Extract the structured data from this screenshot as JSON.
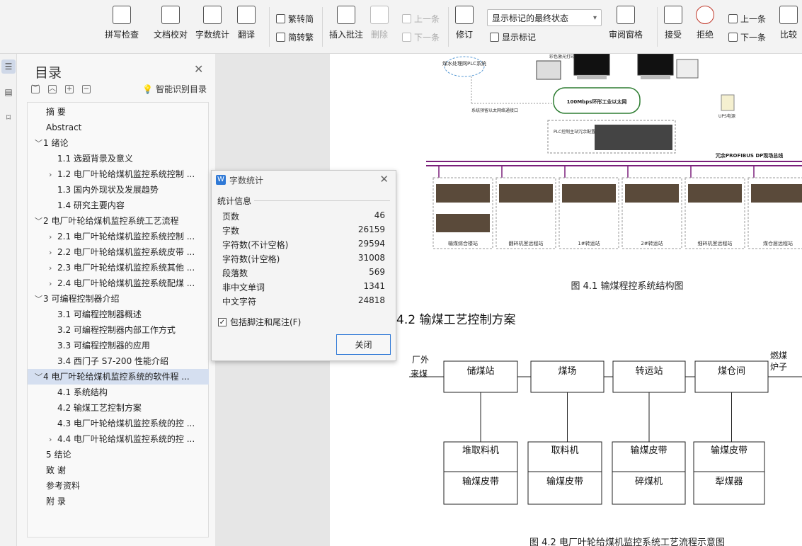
{
  "ribbon": {
    "spell_check": "拼写检查",
    "doc_proof": "文档校对",
    "word_count": "字数统计",
    "translate": "翻译",
    "to_traditional": "繁转简",
    "to_simplified": "简转繁",
    "insert_comment": "插入批注",
    "delete": "删除",
    "prev_comment": "上一条",
    "next_comment": "下一条",
    "revise": "修订",
    "track_state": "显示标记的最终状态",
    "show_markup": "显示标记",
    "review_pane": "审阅窗格",
    "accept": "接受",
    "reject": "拒绝",
    "prev_change": "上一条",
    "next_change": "下一条",
    "compare": "比较"
  },
  "toc": {
    "title": "目录",
    "smart_label": "智能识别目录",
    "items": [
      {
        "label": "摘  要",
        "indent": 1,
        "arrow": ""
      },
      {
        "label": "Abstract",
        "indent": 1,
        "arrow": ""
      },
      {
        "label": "1 绪论",
        "indent": 0,
        "arrow": "﹀"
      },
      {
        "label": "1.1  选题背景及意义",
        "indent": 2,
        "arrow": ""
      },
      {
        "label": "1.2  电厂叶轮给煤机监控系统控制 ...",
        "indent": 1,
        "arrow": "›"
      },
      {
        "label": "1.3  国内外现状及发展趋势",
        "indent": 2,
        "arrow": ""
      },
      {
        "label": "1.4 研究主要内容",
        "indent": 2,
        "arrow": ""
      },
      {
        "label": "2  电厂叶轮给煤机监控系统工艺流程",
        "indent": 0,
        "arrow": "﹀"
      },
      {
        "label": "2.1  电厂叶轮给煤机监控系统控制 ...",
        "indent": 1,
        "arrow": "›"
      },
      {
        "label": "2.2  电厂叶轮给煤机监控系统皮带 ...",
        "indent": 1,
        "arrow": "›"
      },
      {
        "label": "2.3  电厂叶轮给煤机监控系统其他 ...",
        "indent": 1,
        "arrow": "›"
      },
      {
        "label": "2.4  电厂叶轮给煤机监控系统配煤 ...",
        "indent": 1,
        "arrow": "›"
      },
      {
        "label": "3  可编程控制器介绍",
        "indent": 0,
        "arrow": "﹀"
      },
      {
        "label": "3.1  可编程控制器概述",
        "indent": 2,
        "arrow": ""
      },
      {
        "label": "3.2 可编程控制器内部工作方式",
        "indent": 2,
        "arrow": ""
      },
      {
        "label": "3.3  可编程控制器的应用",
        "indent": 2,
        "arrow": ""
      },
      {
        "label": "3.4  西门子 S7-200 性能介绍",
        "indent": 2,
        "arrow": ""
      },
      {
        "label": "4  电厂叶轮给煤机监控系统的软件程 ...",
        "indent": 0,
        "arrow": "﹀",
        "selected": true
      },
      {
        "label": "4.1 系统结构",
        "indent": 2,
        "arrow": ""
      },
      {
        "label": "4.2  输煤工艺控制方案",
        "indent": 2,
        "arrow": ""
      },
      {
        "label": "4.3  电厂叶轮给煤机监控系统的控 ...",
        "indent": 2,
        "arrow": ""
      },
      {
        "label": "4.4  电厂叶轮给煤机监控系统的控 ...",
        "indent": 1,
        "arrow": "›"
      },
      {
        "label": "5  结论",
        "indent": 1,
        "arrow": ""
      },
      {
        "label": "致  谢",
        "indent": 1,
        "arrow": ""
      },
      {
        "label": "参考资料",
        "indent": 1,
        "arrow": ""
      },
      {
        "label": "附  录",
        "indent": 1,
        "arrow": ""
      }
    ]
  },
  "dialog": {
    "title": "字数统计",
    "section": "统计信息",
    "stats": [
      {
        "label": "页数",
        "value": "46"
      },
      {
        "label": "字数",
        "value": "26159"
      },
      {
        "label": "字符数(不计空格)",
        "value": "29594"
      },
      {
        "label": "字符数(计空格)",
        "value": "31008"
      },
      {
        "label": "段落数",
        "value": "569"
      },
      {
        "label": "非中文单词",
        "value": "1341"
      },
      {
        "label": "中文字符",
        "value": "24818"
      }
    ],
    "checkbox_label": "包括脚注和尾注(F)",
    "close_label": "关闭"
  },
  "doc": {
    "fig1_caption": "图 4.1  输煤程控系统结构图",
    "section_heading": "4.2  输煤工艺控制方案",
    "fig2_caption": "图 4.2  电厂叶轮给煤机监控系统工艺流程示意图",
    "fig1_labels": {
      "plc_coal": "煤水处理网PLC系统",
      "printer": "彩色激光打印机",
      "ethernet": "100Mbps环形工业以太网",
      "reserved": "系统预留以太网络通接口",
      "ups": "UPS电源",
      "plc_master": "PLC控制主站冗余配置",
      "profibus": "冗余PROFIBUS DP现场总线",
      "stations": [
        "输煤综合楼站",
        "翻碎机室远程站",
        "1#转运站",
        "2#转运站",
        "细碎机室远程站",
        "煤仓层远程站"
      ]
    },
    "flow": {
      "input": [
        "厂外",
        "来煤"
      ],
      "output": [
        "燃煤",
        "炉子"
      ],
      "top": [
        "储煤站",
        "煤场",
        "转运站",
        "煤仓间"
      ],
      "bottom": [
        [
          "堆取料机",
          "输煤皮带"
        ],
        [
          "取料机",
          "输煤皮带"
        ],
        [
          "输煤皮带",
          "碎煤机"
        ],
        [
          "输煤皮带",
          "犁煤器"
        ]
      ]
    }
  }
}
